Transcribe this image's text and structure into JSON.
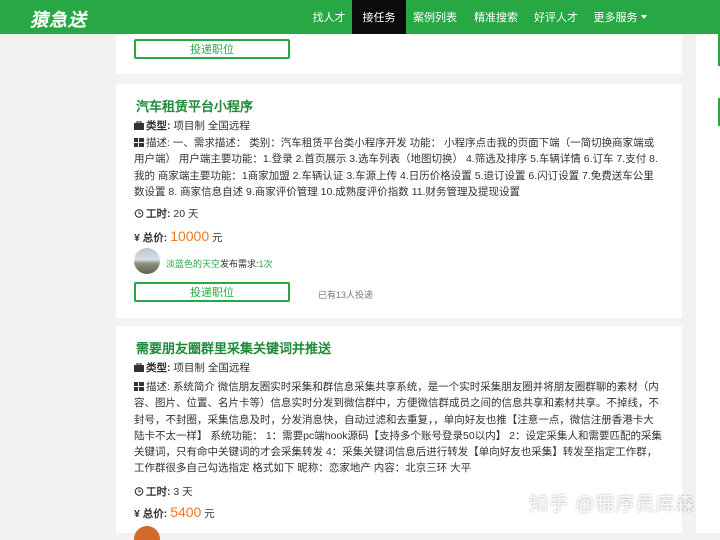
{
  "header": {
    "logo": "猿急送",
    "nav": [
      {
        "label": "找人才"
      },
      {
        "label": "接任务"
      },
      {
        "label": "案例列表"
      },
      {
        "label": "精准搜索"
      },
      {
        "label": "好评人才"
      },
      {
        "label": "更多服务"
      }
    ]
  },
  "labels": {
    "apply": "投递职位",
    "type": "类型:",
    "desc": "描述:",
    "duration": "工时:",
    "total": "总价:",
    "currency_unit": "元",
    "publish_prefix": "发布需求:"
  },
  "jobs": [
    {
      "title": "汽车租赁平台小程序",
      "type_value": "项目制 全国远程",
      "description": "一、需求描述： 类别：汽车租赁平台类小程序开发 功能： 小程序点击我的页面下端（一简切换商家端或用户端） 用户端主要功能：1.登录 2.首页展示 3.选车列表（地图切换） 4.筛选及排序 5.车辆详情 6.订车 7.支付 8.我的 商家端主要功能：1商家加盟 2.车辆认证 3.车源上传 4.日历价格设置 5.退订设置 6.闪订设置 7.免费送车公里数设置 8. 商家信息自述 9.商家评价管理 10.成熟度评价指数 11.财务管理及提现设置",
      "duration_value": "20 天",
      "price": "10000",
      "user_name": "淡蓝色的天空",
      "publish_count": "1次",
      "applied_text": "已有13人投递"
    },
    {
      "title": "需要朋友圈群里采集关键词并推送",
      "type_value": "项目制 全国远程",
      "description": "系统简介 微信朋友圈实时采集和群信息采集共享系统，是一个实时采集朋友圈并将朋友圈群聊的素材（内容、图片、位置、名片卡等）信息实时分发到微信群中，方便微信群成员之间的信息共享和素材共享。不掉线，不封号，不封圈，采集信息及时，分发消息快，自动过滤和去重复，，单向好友也推【注意一点，微信注册香港卡大陆卡不太一样】 系统功能： 1：需要pc端hook源码【支持多个账号登录50以内】 2：设定采集人和需要匹配的采集关键词，只有命中关键词的才会采集转发 4：采集关键词信息后进行转发【单向好友也采集】转发至指定工作群，工作群很多自己勾选指定 格式如下 昵称：恋家地产 内容：北京三环 大平",
      "duration_value": "3 天",
      "price": "5400"
    }
  ],
  "watermark": "知乎 @程序员库森",
  "colors": {
    "brand_green": "#27a845",
    "title_green": "#1f8a3a",
    "price_orange": "#f47721",
    "nav_active_bg": "#0b0b0b"
  }
}
